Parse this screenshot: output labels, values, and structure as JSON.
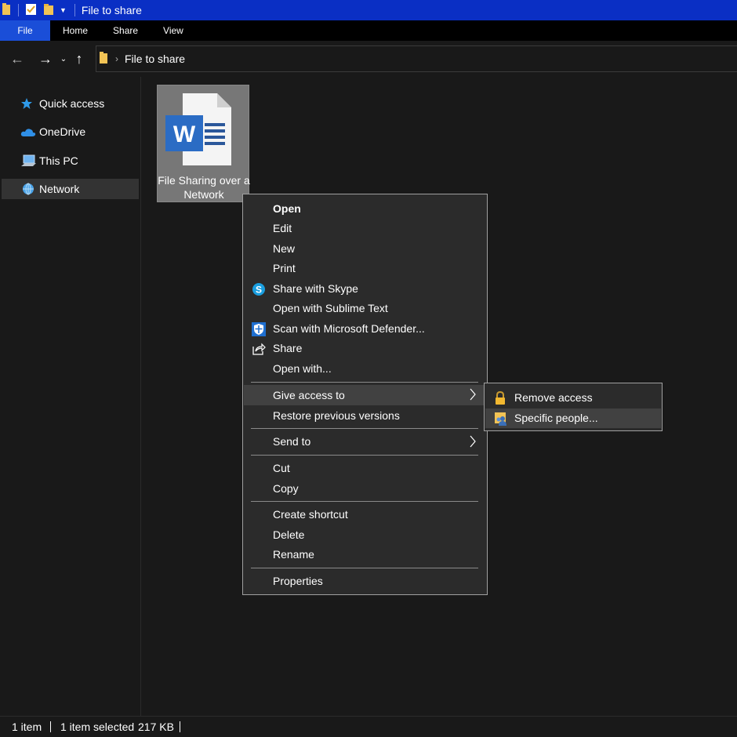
{
  "window": {
    "title": "File to share"
  },
  "ribbon": {
    "tabs": [
      "File",
      "Home",
      "Share",
      "View"
    ]
  },
  "address": {
    "path": "File to share"
  },
  "sidebar": {
    "items": [
      {
        "label": "Quick access",
        "icon": "star-icon"
      },
      {
        "label": "OneDrive",
        "icon": "cloud-icon"
      },
      {
        "label": "This PC",
        "icon": "computer-icon"
      },
      {
        "label": "Network",
        "icon": "network-icon",
        "selected": true
      }
    ]
  },
  "file": {
    "name": "File Sharing over a Network",
    "icon": "word-document-icon"
  },
  "context_menu": {
    "items": [
      {
        "label": "Open"
      },
      {
        "label": "Edit"
      },
      {
        "label": "New"
      },
      {
        "label": "Print"
      },
      {
        "label": "Share with Skype",
        "icon": "skype-icon"
      },
      {
        "label": "Open with Sublime Text"
      },
      {
        "label": "Scan with Microsoft Defender...",
        "icon": "defender-shield-icon"
      },
      {
        "label": "Share",
        "icon": "share-icon"
      },
      {
        "label": "Open with..."
      },
      {
        "label": "Give access to",
        "submenu": true,
        "highlighted": true
      },
      {
        "label": "Restore previous versions"
      },
      {
        "label": "Send to",
        "submenu": true
      },
      {
        "label": "Cut"
      },
      {
        "label": "Copy"
      },
      {
        "label": "Create shortcut"
      },
      {
        "label": "Delete"
      },
      {
        "label": "Rename"
      },
      {
        "label": "Properties"
      }
    ]
  },
  "submenu": {
    "items": [
      {
        "label": "Remove access",
        "icon": "lock-icon"
      },
      {
        "label": "Specific people...",
        "icon": "people-icon",
        "highlighted": true
      }
    ]
  },
  "status": {
    "item_count": "1 item",
    "selected": "1 item selected",
    "size": "217 KB"
  },
  "colors": {
    "titlebar": "#0a2fc4",
    "file_tab": "#1a4ed8",
    "background": "#191919",
    "menu": "#2b2b2b",
    "highlight": "#414141"
  }
}
